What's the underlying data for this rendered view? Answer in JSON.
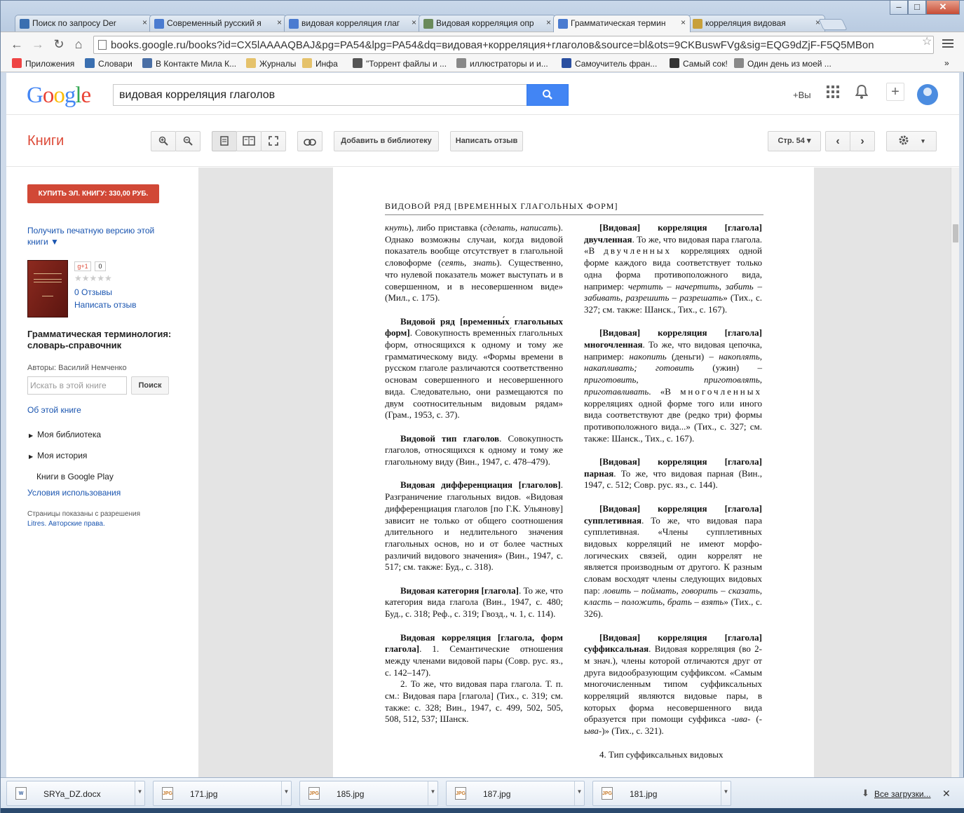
{
  "tabs": [
    {
      "label": "Поиск по запросу Der",
      "icon": "arrow-icon",
      "color": "#3a6fb0"
    },
    {
      "label": "Современный русский я",
      "icon": "google-books-icon",
      "color": "#4a7bd0"
    },
    {
      "label": "видовая корреляция глаг",
      "icon": "google-books-icon",
      "color": "#4a7bd0"
    },
    {
      "label": "Видовая корреляция опр",
      "icon": "tl-icon",
      "color": "#6a8a5a"
    },
    {
      "label": "Грамматическая термин",
      "icon": "google-books-icon",
      "color": "#4a7bd0"
    },
    {
      "label": "корреляция видовая",
      "icon": "chart-icon",
      "color": "#c8a03a"
    }
  ],
  "address": "books.google.ru/books?id=CX5lAAAAQBAJ&pg=PA54&lpg=PA54&dq=видовая+корреляция+глаголов&source=bl&ots=9CKBuswFVg&sig=EQG9dZjF-F5Q5MBon",
  "bookmarks": [
    {
      "label": "Приложения",
      "color": "#e44"
    },
    {
      "label": "Словари",
      "color": "#3a6fb0"
    },
    {
      "label": "В Контакте Мила К...",
      "color": "#4a6fa5"
    },
    {
      "label": "Журналы",
      "color": "#e5c26b"
    },
    {
      "label": "Инфа",
      "color": "#e5c26b"
    },
    {
      "label": "\"Торрент файлы и ...",
      "color": "#555"
    },
    {
      "label": "иллюстраторы и и...",
      "color": "#888"
    },
    {
      "label": "Самоучитель фран...",
      "color": "#2a4fa0"
    },
    {
      "label": "Самый сок!",
      "color": "#333"
    },
    {
      "label": "Один день из моей ...",
      "color": "#888"
    }
  ],
  "header": {
    "search_value": "видовая корреляция глаголов",
    "plus_you": "+Вы"
  },
  "books_bar": {
    "section": "Книги",
    "add_library": "Добавить в библиотеку",
    "write_review": "Написать отзыв",
    "page_select": "Стр. 54"
  },
  "sidebar": {
    "buy": "КУПИТЬ ЭЛ. КНИГУ: 330,00 РУБ.",
    "print_version": "Получить печатную версию этой книги ▼",
    "gplus": "g+1",
    "gplus_count": "0",
    "rating_stars": "★★★★★",
    "reviews": "0 Отзывы",
    "write_review": "Написать отзыв",
    "title": "Грамматическая терминология: словарь-справочник",
    "authors": "Авторы: Василий Немченко",
    "search_placeholder": "Искать в этой книге",
    "search_button": "Поиск",
    "about": "Об этой книге",
    "my_library": "Моя библиотека",
    "my_history": "Моя история",
    "play": "Книги в Google Play",
    "terms": "Условия использования",
    "permission": "Страницы показаны с разрешения",
    "permission_link": "Litres. Авторские права."
  },
  "page": {
    "running_head": "ВИДОВОЙ РЯД [ВРЕМЕННЫХ ГЛАГОЛЬНЫХ ФОРМ]"
  },
  "downloads": [
    {
      "name": "SRYa_DZ.docx",
      "type": "W"
    },
    {
      "name": "171.jpg",
      "type": "JPG"
    },
    {
      "name": "185.jpg",
      "type": "JPG"
    },
    {
      "name": "187.jpg",
      "type": "JPG"
    },
    {
      "name": "181.jpg",
      "type": "JPG"
    }
  ],
  "all_downloads": "Все загрузки..."
}
